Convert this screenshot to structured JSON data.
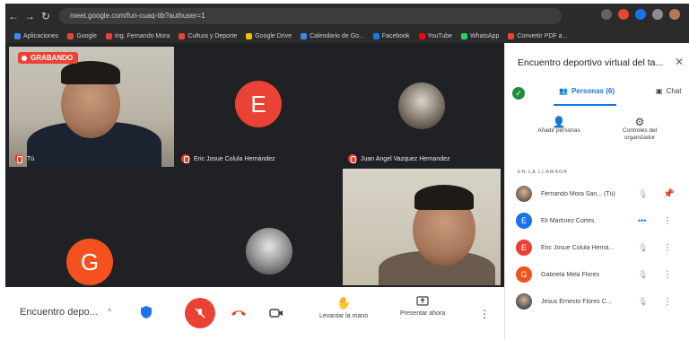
{
  "browser": {
    "url": "meet.google.com/fun-cuaq-tib?authuser=1",
    "bookmarks": [
      {
        "label": "Aplicaciones",
        "color": "#4285f4"
      },
      {
        "label": "Google",
        "color": "#ea4335"
      },
      {
        "label": "Ing. Fernando Mora",
        "color": "#ea4335"
      },
      {
        "label": "Cultura y Deporte",
        "color": "#ea4335"
      },
      {
        "label": "Google Drive",
        "color": "#fbbc04"
      },
      {
        "label": "Calendario de Go...",
        "color": "#4285f4"
      },
      {
        "label": "Facebook",
        "color": "#1877f2"
      },
      {
        "label": "YouTube",
        "color": "#ff0000"
      },
      {
        "label": "WhatsApp",
        "color": "#25d366"
      },
      {
        "label": "Convertir PDF a...",
        "color": "#ea4335"
      }
    ]
  },
  "stage": {
    "recording_label": "GRABANDO",
    "tiles": [
      {
        "name": "Tú",
        "type": "video"
      },
      {
        "name": "Eric Josue Colula Hernández",
        "type": "letter",
        "letter": "E",
        "color": "#ea4335"
      },
      {
        "name": "Juan Angel Vazquez Hernandez",
        "type": "thumb"
      },
      {
        "name": "",
        "type": "letter",
        "letter": "G",
        "color": "#f4511e"
      },
      {
        "name": "",
        "type": "thumb"
      },
      {
        "name": "",
        "type": "video"
      }
    ]
  },
  "bottombar": {
    "meeting_name": "Encuentro depo...",
    "raise_hand_label": "Levantar la mano",
    "present_label": "Presentar ahora"
  },
  "panel": {
    "title": "Encuentro deportivo virtual del ta...",
    "tab_people": "Personas (6)",
    "tab_chat": "Chat",
    "add_people_label": "Añadir personas",
    "host_controls_label": "Controles del organizador",
    "section_label": "EN LA LLAMADA",
    "participants": [
      {
        "name": "Fernando Mora San... (Tú)",
        "avatar_type": "photo",
        "color": "#6d5a4b",
        "letter": ""
      },
      {
        "name": "Eli Martínez Cortes",
        "avatar_type": "letter",
        "color": "#1a73e8",
        "letter": "E"
      },
      {
        "name": "Eric Josue Colula Herná...",
        "avatar_type": "letter",
        "color": "#ea4335",
        "letter": "E"
      },
      {
        "name": "Gabriela Mela Flores",
        "avatar_type": "letter",
        "color": "#f4511e",
        "letter": "G"
      },
      {
        "name": "Jesus Ernesto Flores C...",
        "avatar_type": "photo",
        "color": "#4a4a4a",
        "letter": ""
      }
    ]
  }
}
